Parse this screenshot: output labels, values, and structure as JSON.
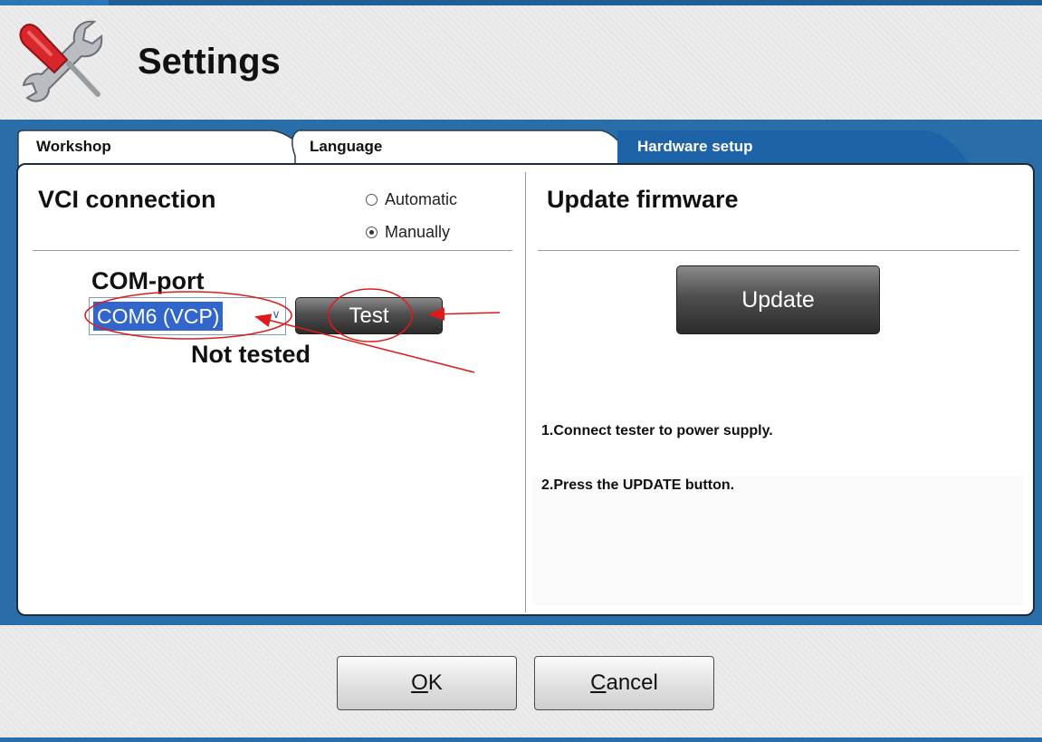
{
  "header": {
    "title": "Settings",
    "logo_icon": "tools-icon"
  },
  "tabs": [
    {
      "label": "Workshop",
      "active": false
    },
    {
      "label": "Language",
      "active": false
    },
    {
      "label": "Hardware setup",
      "active": true
    }
  ],
  "vci": {
    "title": "VCI connection",
    "options": [
      {
        "label": "Automatic",
        "checked": false
      },
      {
        "label": "Manually",
        "checked": true
      }
    ],
    "com_label": "COM-port",
    "com_value": "COM6 (VCP)",
    "test_label": "Test",
    "status": "Not tested"
  },
  "firmware": {
    "title": "Update firmware",
    "update_label": "Update",
    "instructions": [
      "1.Connect tester to power supply.",
      "2.Press the UPDATE button."
    ]
  },
  "footer": {
    "ok_label": "OK",
    "ok_mnemonic": "O",
    "ok_rest": "K",
    "cancel_label": "Cancel",
    "cancel_mnemonic": "C",
    "cancel_rest": "ancel"
  },
  "colors": {
    "accent_blue": "#2a6ea9",
    "tab_active": "#1e63a7",
    "annotation_red": "#e01a1a",
    "selection_blue": "#3366cc"
  }
}
